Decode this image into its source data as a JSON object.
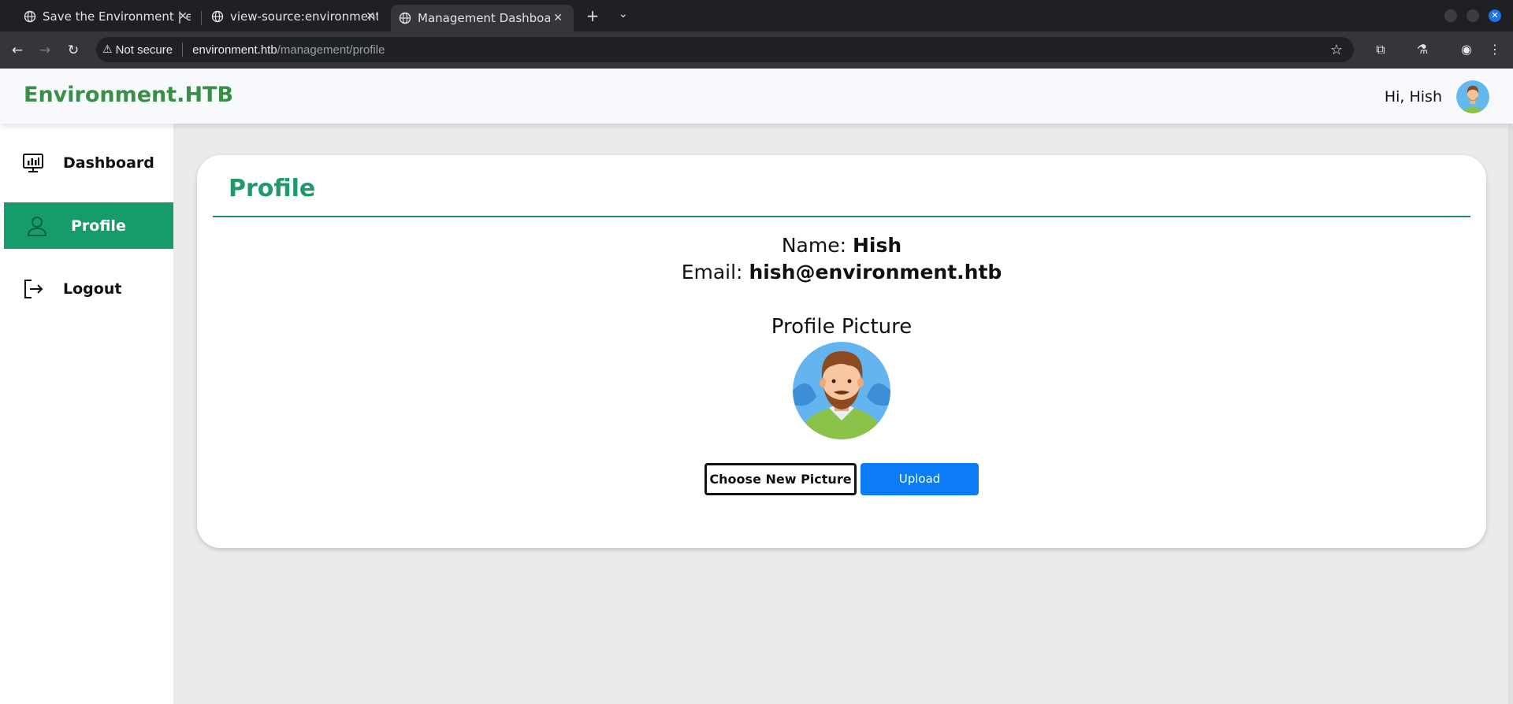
{
  "browser": {
    "tabs": [
      {
        "title": "Save the Environment | environment.htb"
      },
      {
        "title": "view-source:environment.htb"
      },
      {
        "title": "Management Dashboard"
      }
    ],
    "security_label": "Not secure",
    "url_host": "environment.htb",
    "url_path": "/management/profile"
  },
  "header": {
    "brand": "Environment.HTB",
    "greeting": "Hi, Hish"
  },
  "sidebar": {
    "items": [
      {
        "label": "Dashboard"
      },
      {
        "label": "Profile"
      },
      {
        "label": "Logout"
      }
    ]
  },
  "profile": {
    "title": "Profile",
    "name_label": "Name:",
    "name_value": "Hish",
    "email_label": "Email:",
    "email_value": "hish@environment.htb",
    "picture_label": "Profile Picture",
    "choose_button": "Choose New Picture",
    "upload_button": "Upload"
  },
  "colors": {
    "accent": "#169c6b",
    "brand": "#3a8f47",
    "upload": "#0b7cf5"
  }
}
